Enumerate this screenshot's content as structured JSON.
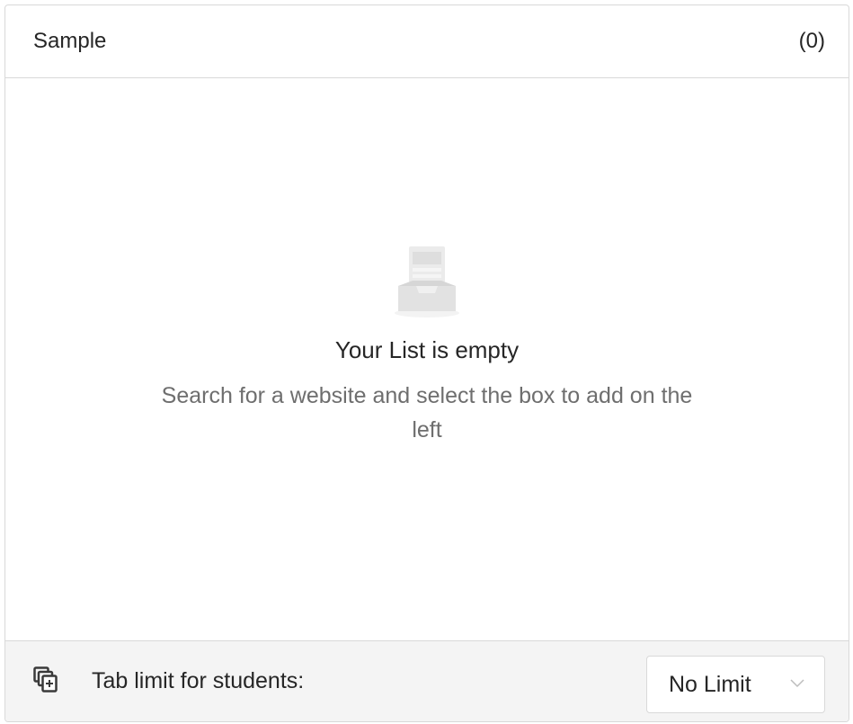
{
  "list": {
    "title": "Sample",
    "count": "(0)"
  },
  "empty_state": {
    "icon": "empty-inbox-icon",
    "title": "Your List is empty",
    "description": "Search for a website and select the box to add on the left"
  },
  "footer": {
    "icon": "tabs-add-icon",
    "label": "Tab limit for students:",
    "limit_select": {
      "value": "No Limit",
      "icon": "chevron-down-icon"
    }
  },
  "colors": {
    "border": "#d9d9d9",
    "footer_bg": "#f4f4f4",
    "text_primary": "#262626",
    "text_secondary": "#6e6e6e",
    "icon_gray": "#dcdcdc"
  }
}
